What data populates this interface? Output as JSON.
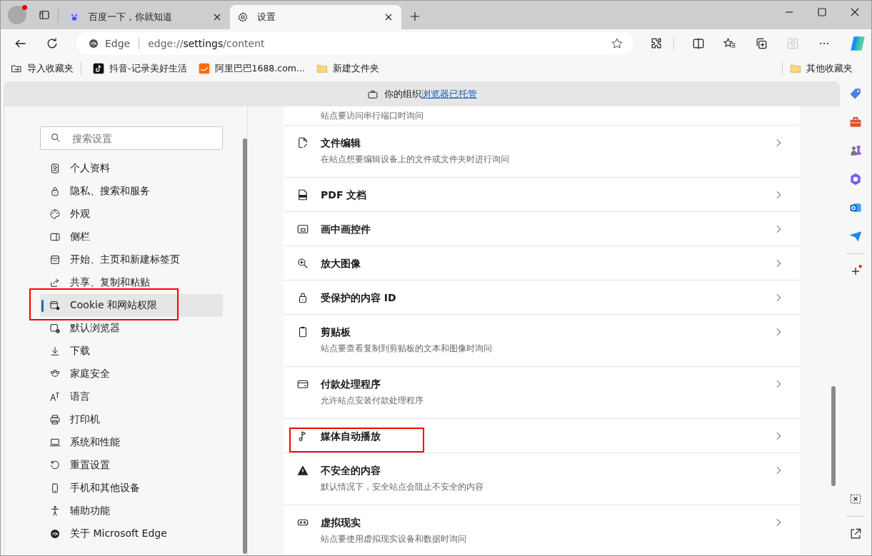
{
  "tabs": [
    {
      "title": "百度一下，你就知道",
      "selected": false
    },
    {
      "title": "设置",
      "selected": true
    }
  ],
  "address": {
    "site_label": "Edge",
    "url_prefix": "edge://",
    "url_host": "settings",
    "url_path": "/content"
  },
  "bookmarks": [
    {
      "label": "导入收藏夹",
      "kind": "import"
    },
    {
      "label": "抖音-记录美好生活",
      "kind": "tiktok"
    },
    {
      "label": "阿里巴巴1688.com...",
      "kind": "alibaba"
    },
    {
      "label": "新建文件夹",
      "kind": "folder"
    }
  ],
  "other_bookmarks": "其他收藏夹",
  "managed_banner": {
    "text": "你的组织",
    "link": "浏览器已托管"
  },
  "settings": {
    "search_placeholder": "搜索设置",
    "nav": [
      {
        "label": "个人资料",
        "selected": false,
        "highlighted": false
      },
      {
        "label": "隐私、搜索和服务",
        "selected": false,
        "highlighted": false
      },
      {
        "label": "外观",
        "selected": false,
        "highlighted": false
      },
      {
        "label": "侧栏",
        "selected": false,
        "highlighted": false
      },
      {
        "label": "开始、主页和新建标签页",
        "selected": false,
        "highlighted": false
      },
      {
        "label": "共享、复制和粘贴",
        "selected": false,
        "highlighted": false
      },
      {
        "label": "Cookie 和网站权限",
        "selected": true,
        "highlighted": true
      },
      {
        "label": "默认浏览器",
        "selected": false,
        "highlighted": false
      },
      {
        "label": "下载",
        "selected": false,
        "highlighted": false
      },
      {
        "label": "家庭安全",
        "selected": false,
        "highlighted": false
      },
      {
        "label": "语言",
        "selected": false,
        "highlighted": false
      },
      {
        "label": "打印机",
        "selected": false,
        "highlighted": false
      },
      {
        "label": "系统和性能",
        "selected": false,
        "highlighted": false
      },
      {
        "label": "重置设置",
        "selected": false,
        "highlighted": false
      },
      {
        "label": "手机和其他设备",
        "selected": false,
        "highlighted": false
      },
      {
        "label": "辅助功能",
        "selected": false,
        "highlighted": false
      },
      {
        "label": "关于 Microsoft Edge",
        "selected": false,
        "highlighted": false
      }
    ]
  },
  "rows": [
    {
      "description": "站点要访问串行端口时询问"
    },
    {
      "title": "文件编辑",
      "description": "在站点想要编辑设备上的文件或文件夹时进行询问",
      "highlighted": false
    },
    {
      "title": "PDF 文档",
      "highlighted": false
    },
    {
      "title": "画中画控件",
      "highlighted": false
    },
    {
      "title": "放大图像",
      "highlighted": false
    },
    {
      "title": "受保护的内容 ID",
      "highlighted": false
    },
    {
      "title": "剪贴板",
      "description": "站点要查看复制到剪贴板的文本和图像时询问",
      "highlighted": false
    },
    {
      "title": "付款处理程序",
      "description": "允许站点安装付款处理程序",
      "highlighted": false
    },
    {
      "title": "媒体自动播放",
      "highlighted": true
    },
    {
      "title": "不安全的内容",
      "description": "默认情况下，安全站点会阻止不安全的内容",
      "highlighted": false
    },
    {
      "title": "虚拟现实",
      "description": "站点要使用虚拟现实设备和数据时询问",
      "highlighted": false
    }
  ]
}
